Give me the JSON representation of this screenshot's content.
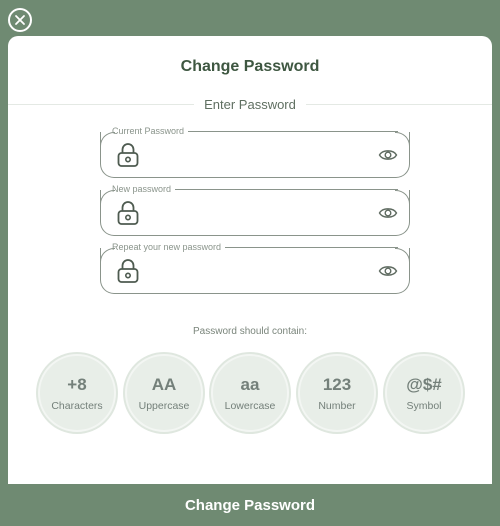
{
  "dialog": {
    "title": "Change Password",
    "section_label": "Enter Password"
  },
  "fields": [
    {
      "label": "Current Password",
      "value": "",
      "placeholder": ""
    },
    {
      "label": "New password",
      "value": "",
      "placeholder": ""
    },
    {
      "label": "Repeat your new password",
      "value": "",
      "placeholder": ""
    }
  ],
  "requirements": {
    "heading": "Password should contain:",
    "items": [
      {
        "symbol": "+8",
        "label": "Characters"
      },
      {
        "symbol": "AA",
        "label": "Uppercase"
      },
      {
        "symbol": "aa",
        "label": "Lowercase"
      },
      {
        "symbol": "123",
        "label": "Number"
      },
      {
        "symbol": "@$#",
        "label": "Symbol"
      }
    ]
  },
  "submit_label": "Change Password",
  "icons": {
    "close": "close-icon",
    "lock": "lock-icon",
    "eye": "eye-icon"
  },
  "colors": {
    "backdrop": "#6f8a72",
    "title": "#3e5741",
    "badge_bg": "#e8eee8",
    "submit_bg": "#6f8a72"
  }
}
